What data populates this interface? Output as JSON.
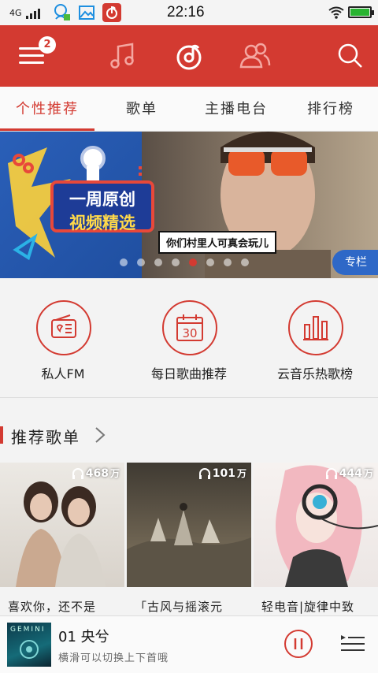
{
  "status_bar": {
    "network": "4G",
    "time": "22:16",
    "battery_level": 1.0,
    "colors": {
      "battery": "#28b331"
    }
  },
  "header": {
    "badge_count": "2",
    "icons": [
      "menu-icon",
      "music-note-icon",
      "netease-logo-icon",
      "friends-icon",
      "search-icon"
    ],
    "colors": {
      "primary": "#d33a31"
    }
  },
  "tabs": [
    {
      "label": "个性推荐",
      "active": true
    },
    {
      "label": "歌单",
      "active": false
    },
    {
      "label": "主播电台",
      "active": false
    },
    {
      "label": "排行榜",
      "active": false
    }
  ],
  "banner": {
    "title_line1": "一周原创",
    "title_line2": "视频精选",
    "caption": "你们村里人可真会玩儿",
    "tag": "专栏",
    "dots_total": 8,
    "dot_active_index": 4
  },
  "quick_entries": [
    {
      "label": "私人FM",
      "icon": "radio-icon"
    },
    {
      "label": "每日歌曲推荐",
      "icon": "calendar-icon",
      "day": "30"
    },
    {
      "label": "云音乐热歌榜",
      "icon": "chart-bars-icon"
    }
  ],
  "section": {
    "title": "推荐歌单"
  },
  "playlists": [
    {
      "count": "468",
      "unit": "万",
      "title": "喜欢你，还不是"
    },
    {
      "count": "101",
      "unit": "万",
      "title": "「古风与摇滚元"
    },
    {
      "count": "444",
      "unit": "万",
      "title": "轻电音|旋律中致"
    }
  ],
  "player": {
    "art_text": "GEMINI",
    "song": "01 央兮",
    "hint": "横滑可以切换上下首哦"
  }
}
